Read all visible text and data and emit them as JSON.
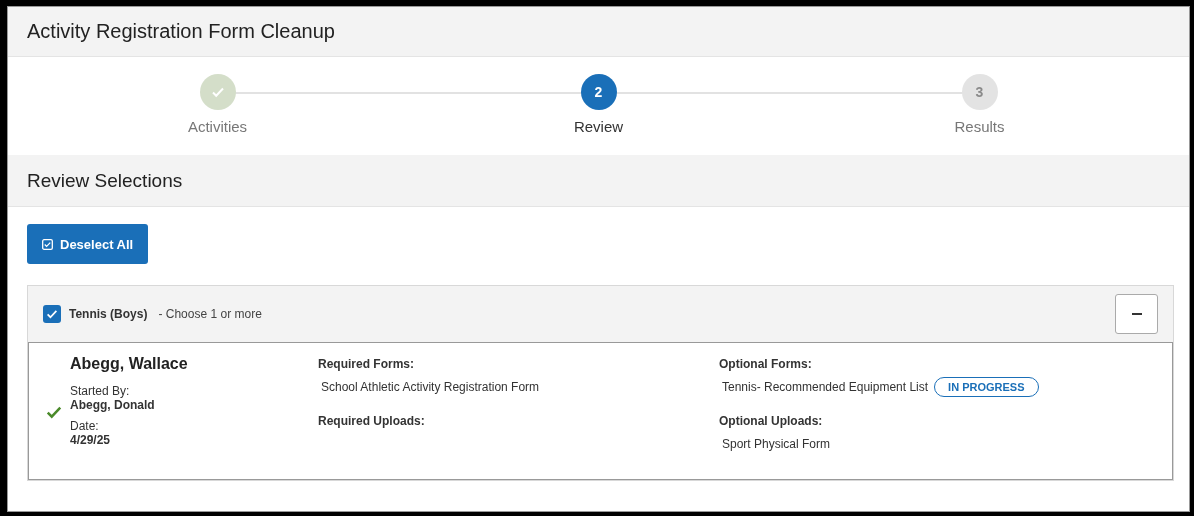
{
  "page_title": "Activity Registration Form Cleanup",
  "steps": [
    {
      "label": "Activities",
      "done": true,
      "selected": false
    },
    {
      "label": "Review",
      "number": "2",
      "done": false,
      "selected": true
    },
    {
      "label": "Results",
      "number": "3",
      "done": false,
      "selected": false
    }
  ],
  "section_title": "Review Selections",
  "deselect_button": "Deselect All",
  "activity": {
    "name": "Tennis (Boys)",
    "hint": "- Choose 1 or more",
    "checked": true,
    "expanded": true,
    "entries": [
      {
        "student": "Abegg, Wallace",
        "complete": true,
        "started_by_label": "Started By:",
        "started_by": "Abegg, Donald",
        "date_label": "Date:",
        "date": "4/29/25",
        "required_forms_label": "Required Forms:",
        "required_forms": [
          {
            "name": "School Athletic Activity Registration Form"
          }
        ],
        "required_uploads_label": "Required Uploads:",
        "optional_forms_label": "Optional Forms:",
        "optional_forms": [
          {
            "name": "Tennis- Recommended Equipment List",
            "status": "IN PROGRESS"
          }
        ],
        "optional_uploads_label": "Optional Uploads:",
        "optional_uploads": [
          {
            "name": "Sport Physical Form"
          }
        ]
      }
    ]
  }
}
